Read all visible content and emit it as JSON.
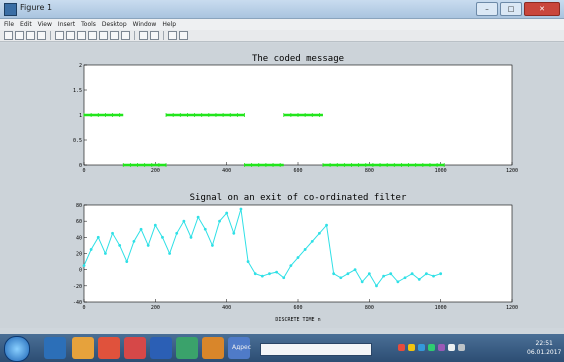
{
  "window": {
    "title": "Figure 1",
    "controls": [
      "–",
      "□",
      "✕"
    ]
  },
  "menubar": {
    "items": [
      "File",
      "Edit",
      "View",
      "Insert",
      "Tools",
      "Desktop",
      "Window",
      "Help"
    ]
  },
  "plot_top": {
    "title": "The coded message"
  },
  "plot_bottom": {
    "title": "Signal on an exit of co-ordinated filter",
    "xlabel": "DISCRETE TIME  n"
  },
  "chart_data": [
    {
      "type": "line",
      "title": "The coded message",
      "xlabel": "",
      "ylabel": "",
      "xlim": [
        0,
        1200
      ],
      "ylim": [
        0,
        2
      ],
      "xticks": [
        "0",
        "200",
        "400",
        "600",
        "800",
        "1000",
        "1200"
      ],
      "yticks": [
        "0",
        "0.5",
        "1",
        "1.5",
        "2"
      ],
      "color": "#22e51c",
      "segments": [
        {
          "x": [
            0,
            110
          ],
          "y": 1
        },
        {
          "x": [
            110,
            230
          ],
          "y": 0
        },
        {
          "x": [
            230,
            450
          ],
          "y": 1
        },
        {
          "x": [
            450,
            560
          ],
          "y": 0
        },
        {
          "x": [
            560,
            670
          ],
          "y": 1
        },
        {
          "x": [
            670,
            1010
          ],
          "y": 0
        }
      ]
    },
    {
      "type": "scatter",
      "title": "Signal on an exit of co-ordinated filter",
      "xlabel": "DISCRETE TIME  n",
      "ylabel": "",
      "xlim": [
        0,
        1200
      ],
      "ylim": [
        -40,
        80
      ],
      "xticks": [
        "0",
        "200",
        "400",
        "600",
        "800",
        "1000",
        "1200"
      ],
      "yticks": [
        "-40",
        "-20",
        "0",
        "20",
        "40",
        "60",
        "80"
      ],
      "color": "#2fe0e6",
      "x": [
        0,
        20,
        40,
        60,
        80,
        100,
        120,
        140,
        160,
        180,
        200,
        220,
        240,
        260,
        280,
        300,
        320,
        340,
        360,
        380,
        400,
        420,
        440,
        460,
        480,
        500,
        520,
        540,
        560,
        580,
        600,
        620,
        640,
        660,
        680,
        700,
        720,
        740,
        760,
        780,
        800,
        820,
        840,
        860,
        880,
        900,
        920,
        940,
        960,
        980,
        1000
      ],
      "y": [
        5,
        25,
        40,
        20,
        45,
        30,
        10,
        35,
        50,
        30,
        55,
        40,
        20,
        45,
        60,
        40,
        65,
        50,
        30,
        60,
        70,
        45,
        75,
        10,
        -5,
        -8,
        -5,
        -3,
        -10,
        5,
        15,
        25,
        35,
        45,
        55,
        -5,
        -10,
        -5,
        0,
        -15,
        -5,
        -20,
        -8,
        -5,
        -15,
        -10,
        -5,
        -12,
        -5,
        -8,
        -5
      ]
    }
  ],
  "taskbar": {
    "search_placeholder": "Адрес",
    "clock_time": "22:51",
    "clock_date": "06.01.2017"
  },
  "colors": {
    "figure_bg": "#ccd3d9",
    "axes_bg": "#ffffff",
    "code_line": "#22e51c",
    "signal": "#2fe0e6"
  }
}
